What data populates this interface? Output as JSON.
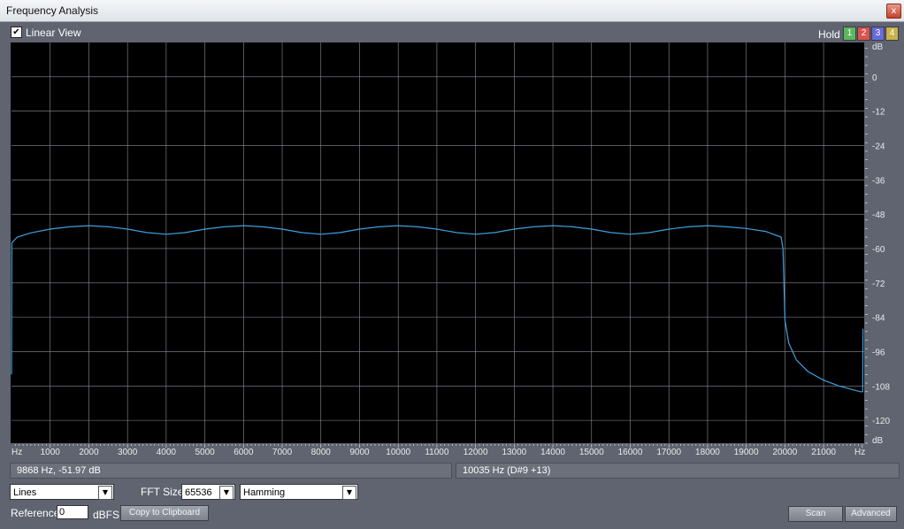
{
  "window": {
    "title": "Frequency Analysis",
    "close_glyph": "x"
  },
  "top": {
    "linear_view_label": "Linear View",
    "linear_view_checked": true,
    "hold_label": "Hold",
    "hold_buttons": [
      {
        "label": "1",
        "color": "#5cb85c"
      },
      {
        "label": "2",
        "color": "#d9534f"
      },
      {
        "label": "3",
        "color": "#6a6ad8"
      },
      {
        "label": "4",
        "color": "#c9b24a"
      }
    ]
  },
  "chart_data": {
    "type": "line",
    "xlabel": "Hz",
    "ylabel": "dB",
    "xlim": [
      0,
      22050
    ],
    "ylim": [
      -128,
      12
    ],
    "x_ticks": [
      1000,
      2000,
      3000,
      4000,
      5000,
      6000,
      7000,
      8000,
      9000,
      10000,
      11000,
      12000,
      13000,
      14000,
      15000,
      16000,
      17000,
      18000,
      19000,
      20000,
      21000
    ],
    "y_ticks": [
      0,
      -12,
      -24,
      -36,
      -48,
      -60,
      -72,
      -84,
      -96,
      -108,
      -120
    ],
    "grid": true,
    "line_color": "#3fa0e0",
    "series": [
      {
        "x": [
          0,
          10,
          150,
          500,
          1000,
          1500,
          2000,
          2500,
          3000,
          3500,
          4000,
          4500,
          5000,
          5500,
          6000,
          6500,
          7000,
          7500,
          8000,
          8500,
          9000,
          9500,
          10000,
          10500,
          11000,
          11500,
          12000,
          12500,
          13000,
          13500,
          14000,
          14500,
          15000,
          15500,
          16000,
          16500,
          17000,
          17500,
          18000,
          18500,
          19000,
          19500,
          19900,
          19950,
          20000,
          20100,
          20300,
          20600,
          21000,
          21400,
          21800,
          21950,
          22010,
          22020
        ],
        "y": [
          -104,
          -58,
          -56,
          -54.5,
          -53.2,
          -52.4,
          -52,
          -52.4,
          -53.2,
          -54.4,
          -55,
          -54.4,
          -53.2,
          -52.4,
          -52,
          -52.4,
          -53.2,
          -54.4,
          -55,
          -54.4,
          -53.2,
          -52.4,
          -52,
          -52.4,
          -53.2,
          -54.4,
          -55,
          -54.4,
          -53.2,
          -52.4,
          -52,
          -52.4,
          -53.2,
          -54.4,
          -55,
          -54.4,
          -53.2,
          -52.4,
          -52,
          -52.4,
          -53,
          -54,
          -56,
          -60,
          -85,
          -93,
          -99,
          -103,
          -106,
          -108,
          -109.5,
          -110,
          -110,
          -88
        ]
      }
    ]
  },
  "status": {
    "cursor_readout": "9868 Hz, -51.97 dB",
    "peak_readout": "10035 Hz (D#9 +13)"
  },
  "controls": {
    "display_mode": "Lines",
    "fft_size_label": "FFT Size",
    "fft_size": "65536",
    "window_fn": "Hamming",
    "reference_label": "Reference",
    "reference_value": "0",
    "reference_unit": "dBFS",
    "copy_button": "Copy to Clipboard",
    "scan_button": "Scan",
    "advanced_button": "Advanced"
  }
}
